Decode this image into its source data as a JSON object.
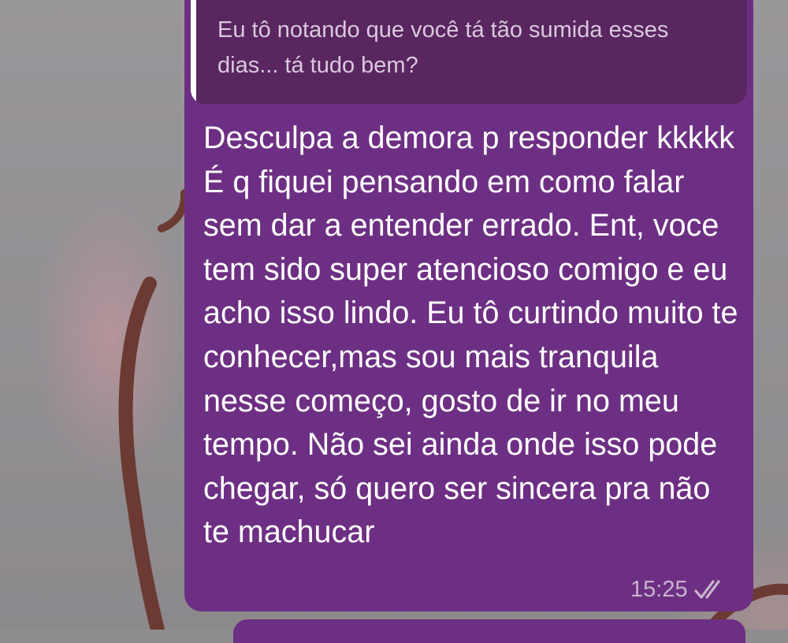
{
  "reply": {
    "quoted_text": "Eu tô notando que você tá tão sumida esses dias... tá tudo bem?",
    "message_text": "Desculpa a demora p responder kkkkk É q fiquei pensando em como falar sem dar a entender errado. Ent, voce tem sido super atencioso comigo e eu acho isso lindo. Eu tô curtindo muito te conhecer,mas sou mais tranquila nesse começo, gosto de ir no meu tempo. Não sei ainda onde isso pode chegar, só quero ser sincera pra não te machucar",
    "time": "15:25",
    "status_icon": "double-check-icon"
  },
  "colors": {
    "bubble": "#6d2f83",
    "quote_bg": "#59265f",
    "quote_bar": "#ffffff",
    "text": "#ffffff",
    "meta_text": "#c7b3cc"
  }
}
